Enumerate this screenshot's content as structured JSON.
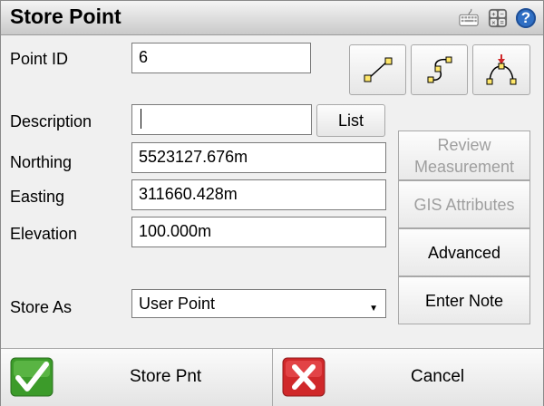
{
  "window": {
    "title": "Store Point"
  },
  "toolbar": {
    "icons": [
      "keyboard-icon",
      "calculator-icon",
      "help-icon"
    ],
    "help_glyph": "?"
  },
  "form": {
    "point_id": {
      "label": "Point ID",
      "value": "6"
    },
    "description": {
      "label": "Description",
      "value": ""
    },
    "list_button": "List",
    "northing": {
      "label": "Northing",
      "value": "5523127.676m"
    },
    "easting": {
      "label": "Easting",
      "value": "311660.428m"
    },
    "elevation": {
      "label": "Elevation",
      "value": "100.000m"
    },
    "store_as": {
      "label": "Store As",
      "value": "User Point"
    }
  },
  "geometry_buttons": [
    "line-icon",
    "curve-icon",
    "arc-intersect-icon"
  ],
  "side_buttons": {
    "review": {
      "label": "Review Measurement",
      "enabled": false
    },
    "gis": {
      "label": "GIS Attributes",
      "enabled": false
    },
    "advanced": {
      "label": "Advanced",
      "enabled": true
    },
    "note": {
      "label": "Enter Note",
      "enabled": true
    }
  },
  "bottom": {
    "store_label": "Store Pnt",
    "cancel_label": "Cancel"
  },
  "colors": {
    "accent_green": "#3c9b2a",
    "accent_red": "#d0282a",
    "help_blue": "#2f6fc4"
  }
}
